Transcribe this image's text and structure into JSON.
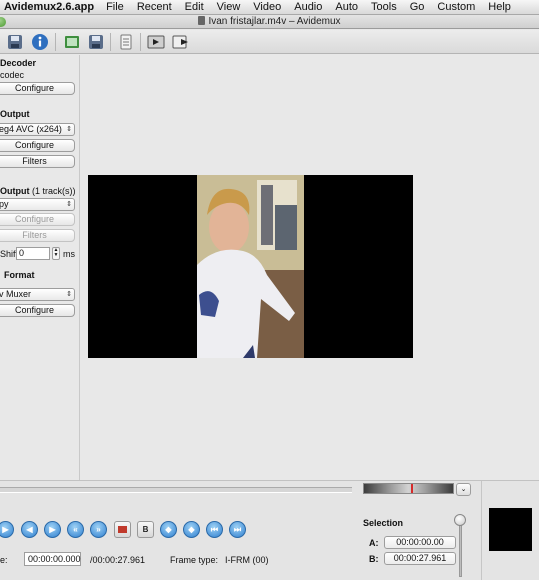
{
  "menubar": {
    "app": "Avidemux2.6.app",
    "items": [
      "File",
      "Recent",
      "Edit",
      "View",
      "Video",
      "Audio",
      "Auto",
      "Tools",
      "Go",
      "Custom",
      "Help"
    ]
  },
  "window": {
    "title": "Ivan fristajlar.m4v – Avidemux"
  },
  "left_panel": {
    "video_decoder": {
      "heading": "Decoder",
      "codec": "codec",
      "configure": "Configure"
    },
    "video_output": {
      "heading": "Output",
      "codec": "eg4 AVC (x264)",
      "configure": "Configure",
      "filters": "Filters"
    },
    "audio_output": {
      "heading": "Output",
      "tracks": "(1 track(s))",
      "codec": "py",
      "configure": "Configure",
      "filters": "Filters",
      "shift_label": "Shift:",
      "shift_value": "0",
      "shift_unit": "ms"
    },
    "format": {
      "heading": "Format",
      "muxer": "v Muxer",
      "configure": "Configure"
    }
  },
  "status_bar": {
    "time_label": "e:",
    "current_time": "00:00:00.000",
    "total_time": "/00:00:27.961",
    "frame_type_label": "Frame type:",
    "frame_type_value": "I-FRM (00)"
  },
  "selection": {
    "title": "Selection",
    "a_label": "A:",
    "a_value": "00:00:00.00",
    "b_label": "B:",
    "b_value": "00:00:27.961"
  },
  "colors": {
    "accent_blue": "#2f7fcf",
    "marker_red": "#d62a2a",
    "video_bg": "#000000"
  }
}
